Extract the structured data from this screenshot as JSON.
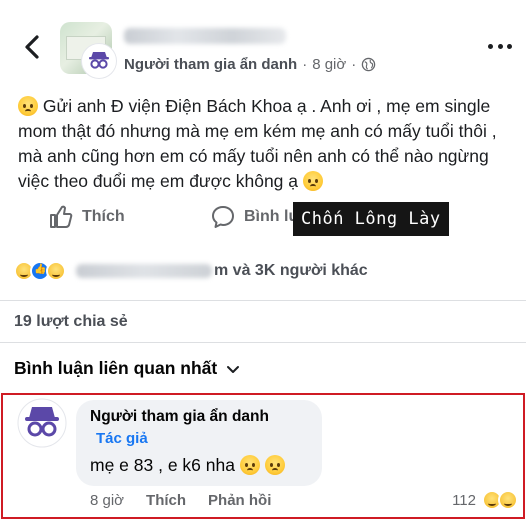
{
  "header": {
    "back_icon": "chevron-left-icon",
    "poster_name": "Người tham gia ẩn danh",
    "separator": "·",
    "time": "8 giờ",
    "separator2": "·",
    "privacy_icon": "globe-icon",
    "more_icon": "more-horizontal-icon"
  },
  "post": {
    "text": "Gửi anh Đ viện Điện Bách Khoa ạ . Anh ơi , mẹ em single mom thật đó nhưng mà mẹ em kém mẹ anh có mấy tuổi thôi , mà anh cũng hơn em có mấy tuổi nên anh có thể nào ngừng việc theo đuổi mẹ em được không ạ"
  },
  "actions": {
    "like_label": "Thích",
    "comment_label": "Bình lu"
  },
  "watermark": "Chốn Lông Lày",
  "reactions": {
    "names_suffix": "m và 3K người khác"
  },
  "shares": "19 lượt chia sẻ",
  "comments_sort": "Bình luận liên quan nhất",
  "comment": {
    "author": "Người tham gia ẩn danh",
    "badge": "Tác giả",
    "text": "mẹ e 83 , e k6 nha",
    "time": "8 giờ",
    "like": "Thích",
    "reply": "Phản hồi",
    "reaction_count": "112"
  },
  "colors": {
    "accent": "#1877f2",
    "highlight_border": "#cf1b24",
    "watermark_bg": "#151515"
  }
}
